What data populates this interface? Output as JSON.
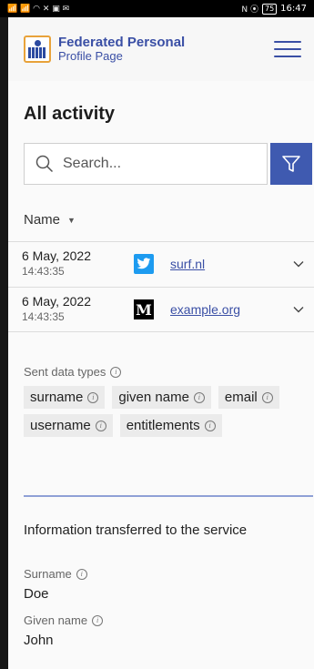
{
  "status_bar": {
    "time": "16:47",
    "battery": "75",
    "signal_icons": "📶 📶 ◠ ✕ ▣ ✉",
    "right_icons": "N ⦿"
  },
  "header": {
    "title": "Federated Personal",
    "subtitle": "Profile Page"
  },
  "page": {
    "title": "All activity"
  },
  "search": {
    "placeholder": "Search..."
  },
  "table": {
    "column_header": "Name",
    "rows": [
      {
        "date": "6 May, 2022",
        "time": "14:43:35",
        "service": "surf.nl",
        "icon": "twitter-icon"
      },
      {
        "date": "6 May, 2022",
        "time": "14:43:35",
        "service": "example.org",
        "icon": "medium-icon"
      }
    ]
  },
  "details": {
    "sent_label": "Sent data types",
    "data_types": [
      "surname",
      "given name",
      "email",
      "username",
      "entitlements"
    ],
    "info_glyph": "i",
    "section_title": "Information transferred to the service",
    "fields": [
      {
        "label": "Surname",
        "value": "Doe"
      },
      {
        "label": "Given name",
        "value": "John"
      }
    ]
  },
  "medium_glyph": "M",
  "colors": {
    "brand": "#3a4fa5",
    "filter_button": "#3f5ab0",
    "twitter": "#1d9bf0"
  }
}
